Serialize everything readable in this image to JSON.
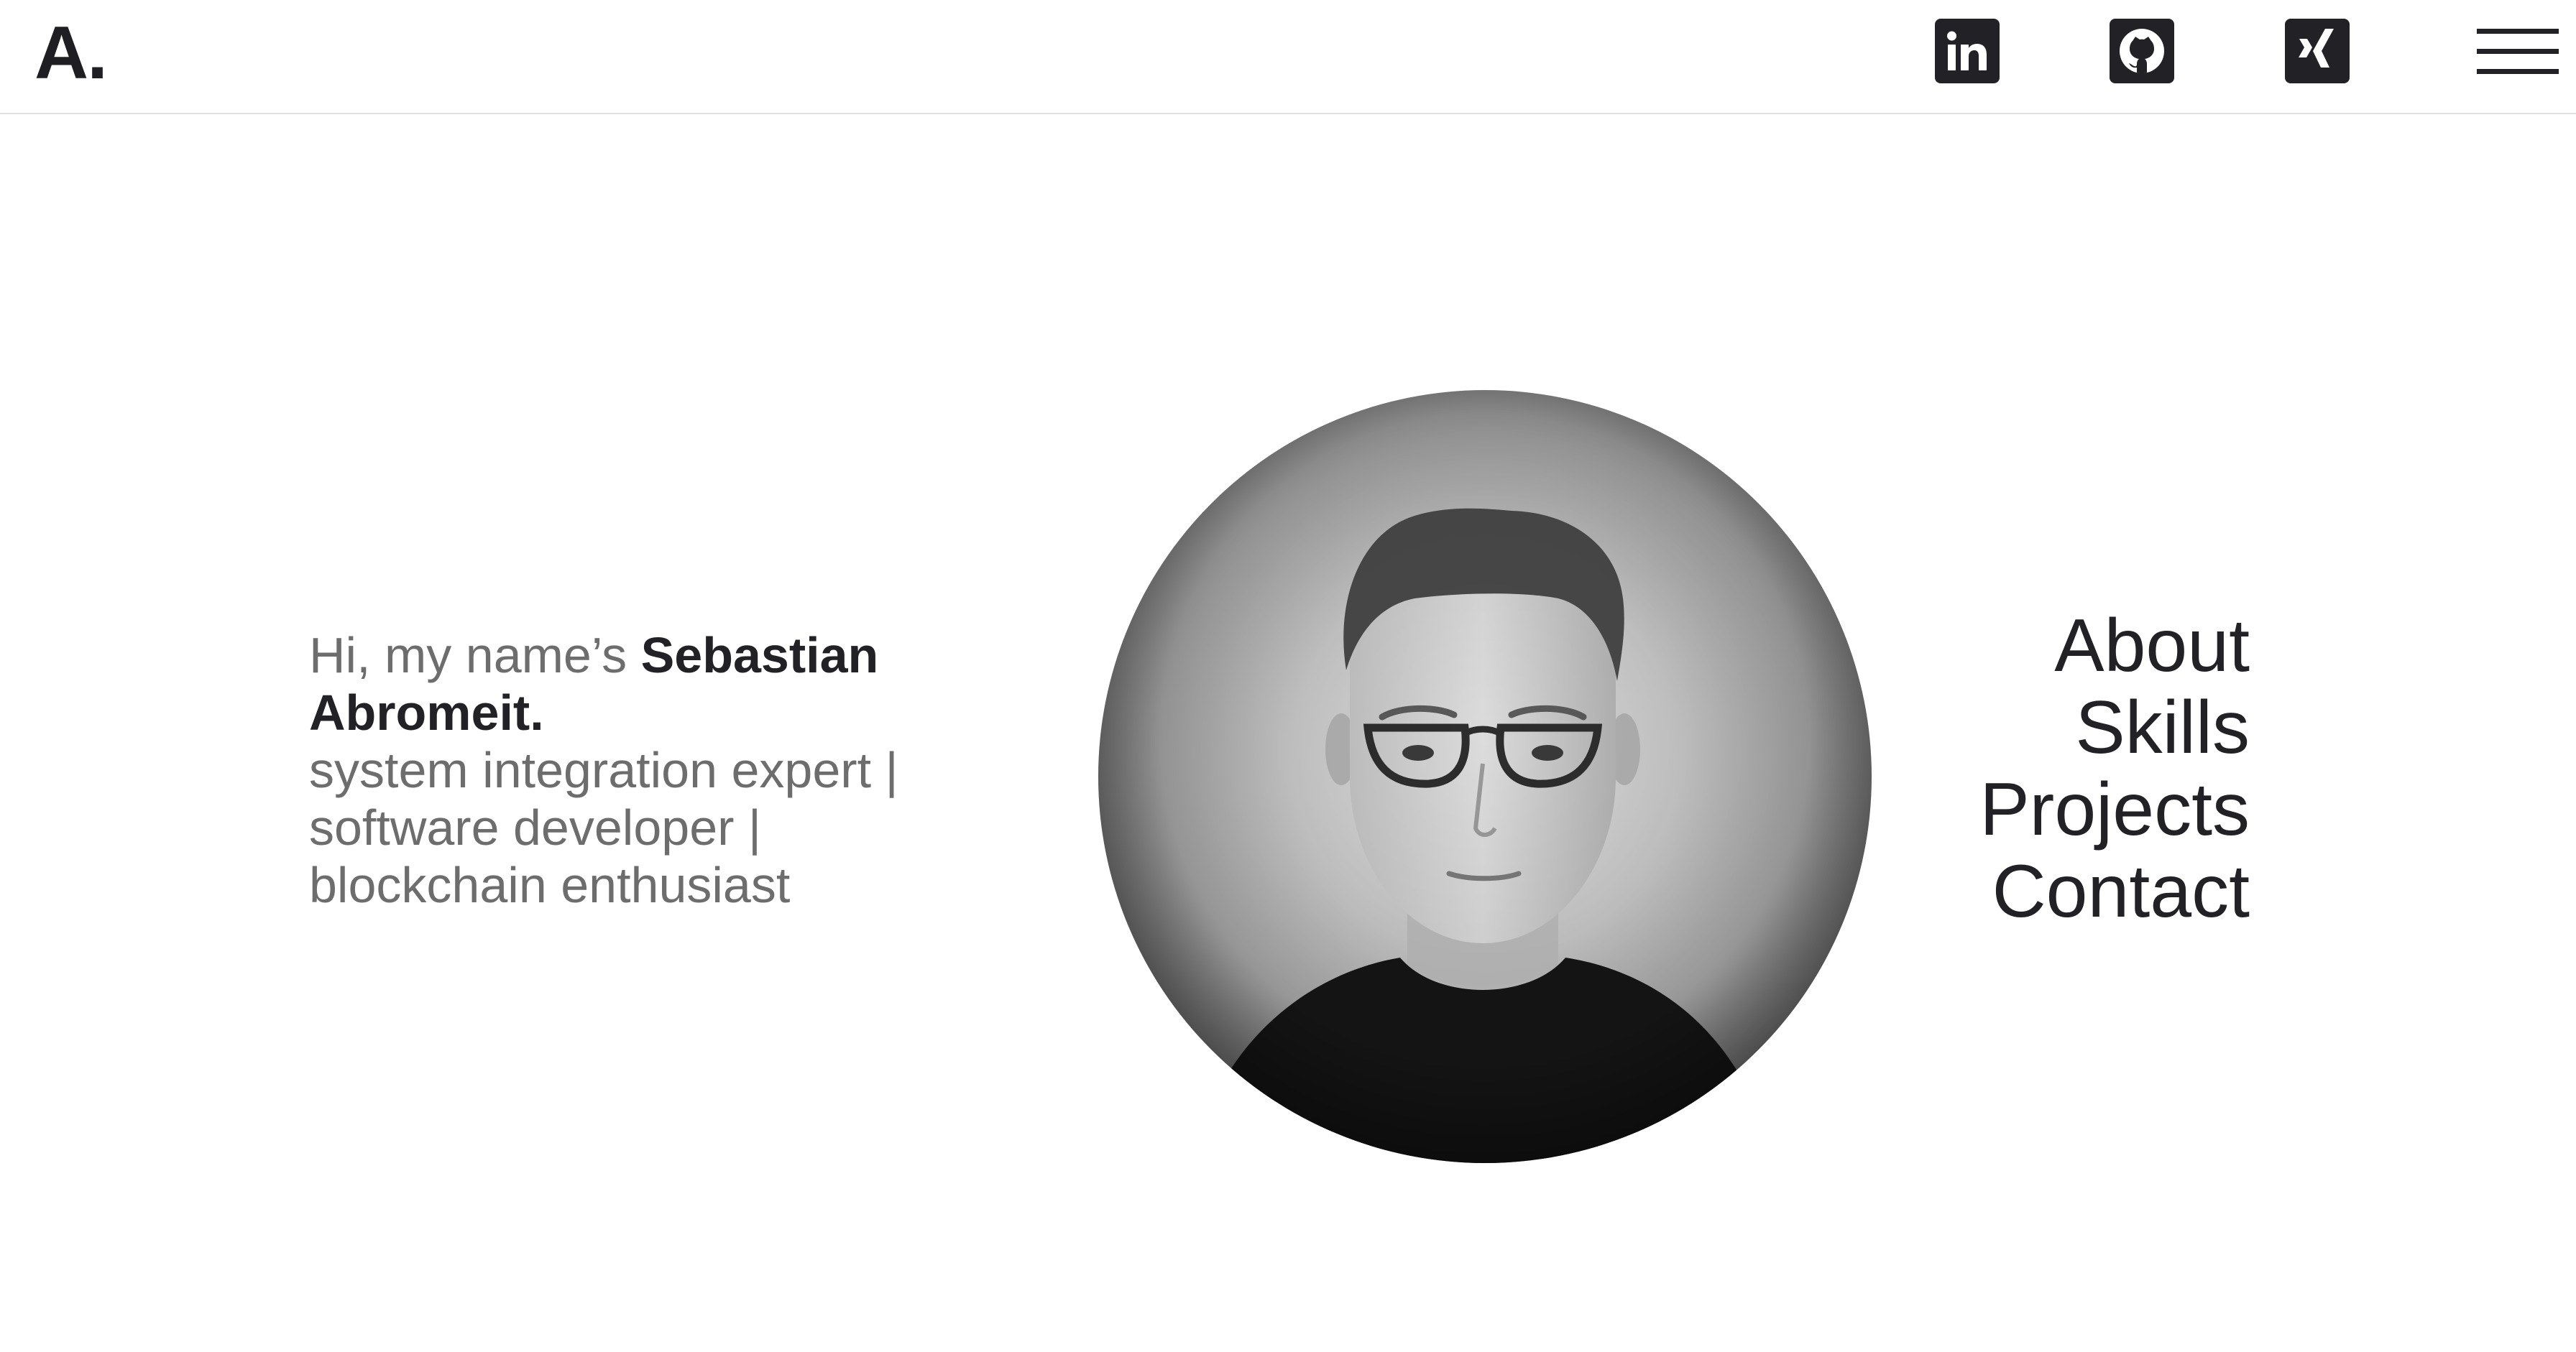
{
  "header": {
    "logo": "A.",
    "social_links": [
      {
        "icon": "linkedin-icon"
      },
      {
        "icon": "github-icon"
      },
      {
        "icon": "xing-icon"
      }
    ],
    "menu_icon": "hamburger-menu-icon"
  },
  "intro": {
    "greeting": "Hi, my name’s ",
    "name": "Sebastian Abromeit.",
    "role_1": "system integration expert |",
    "role_2": "software developer |",
    "role_3": "blockchain enthusiast"
  },
  "portrait": {
    "style": "black-and-white circular portrait"
  },
  "nav": {
    "items": [
      "About",
      "Skills",
      "Projects",
      "Contact"
    ]
  },
  "colors": {
    "text_dark": "#222226",
    "text_muted": "#6d6d6d",
    "divider": "#e0e0e0",
    "background": "#ffffff"
  }
}
